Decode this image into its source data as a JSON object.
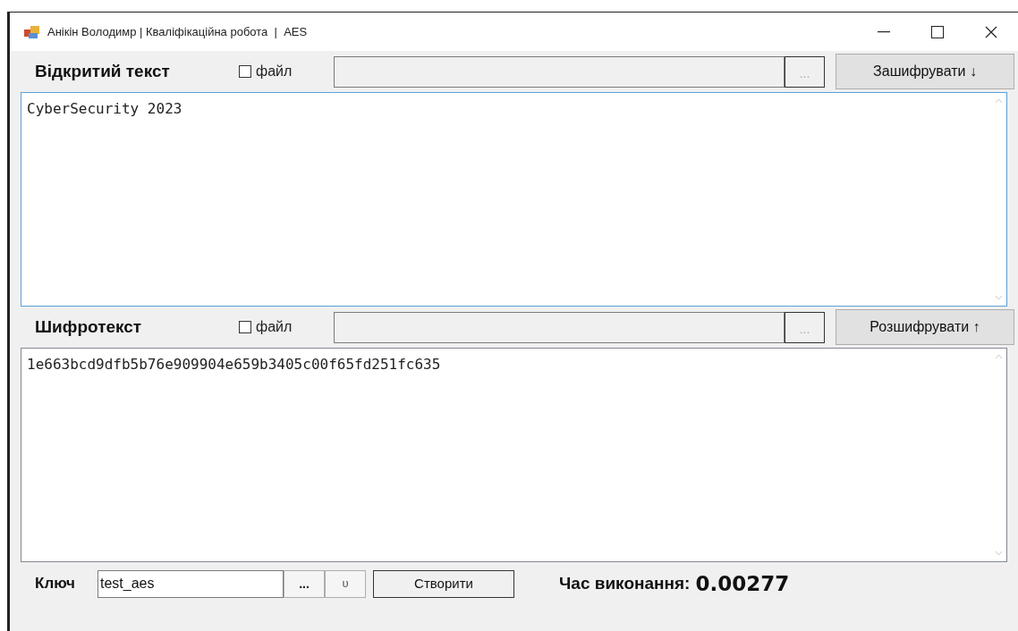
{
  "window": {
    "title": "Анікін Володимр | Кваліфікаційна робота  |  AES"
  },
  "sections": [
    {
      "label": "Відкритий текст",
      "file_checkbox": {
        "label": "файл",
        "checked": false
      },
      "file_path": {
        "browse": "..."
      },
      "action": "Зашифрувати ↓",
      "text": "CyberSecurity 2023",
      "focused": true
    },
    {
      "label": "Шифротекст",
      "file_checkbox": {
        "label": "файл",
        "checked": false
      },
      "file_path": {
        "browse": "..."
      },
      "action": "Розшифрувати ↑",
      "text": "1e663bcd9dfb5b76e909904e659b3405c00f65fd251fc635",
      "focused": false
    }
  ],
  "key": {
    "label": "Ключ",
    "value": "test_aes",
    "browse": "...",
    "reset": "υ",
    "create": "Створити"
  },
  "timing": {
    "label": "Час виконання:",
    "value": "0.00277"
  }
}
